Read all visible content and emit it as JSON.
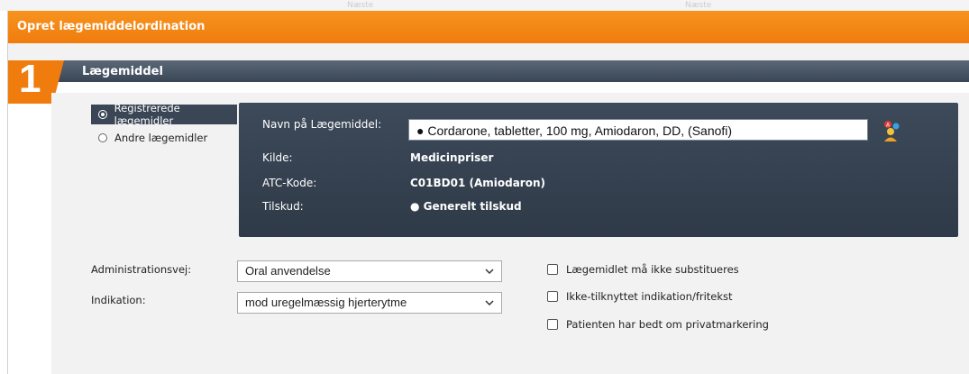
{
  "background_tabs": {
    "ghost_left": "Næste",
    "ghost_right": "Næste"
  },
  "dialog": {
    "title": "Opret lægemiddelordination"
  },
  "section": {
    "number": "1",
    "title": "Lægemiddel"
  },
  "source_options": [
    {
      "label": "Registrerede lægemidler",
      "selected": true
    },
    {
      "label": "Andre lægemidler",
      "selected": false
    }
  ],
  "drug_panel": {
    "name_label": "Navn på Lægemiddel:",
    "name_value": "● Cordarone, tabletter, 100 mg, Amiodaron, DD, (Sanofi)",
    "source_label": "Kilde:",
    "source_value": "Medicinpriser",
    "atc_label": "ATC-Kode:",
    "atc_value": "C01BD01 (Amiodaron)",
    "subsidy_label": "Tilskud:",
    "subsidy_value": "● Generelt tilskud",
    "lookup_icon": "drug-lookup-icon"
  },
  "form": {
    "route_label": "Administrationsvej:",
    "route_value": "Oral anvendelse",
    "indication_label": "Indikation:",
    "indication_value": "mod uregelmæssig hjerterytme"
  },
  "checkboxes": [
    {
      "label": "Lægemidlet må ikke substitueres",
      "checked": false
    },
    {
      "label": "Ikke-tilknyttet indikation/fritekst",
      "checked": false
    },
    {
      "label": "Patienten har bedt om privatmarkering",
      "checked": false
    }
  ],
  "colors": {
    "accent": "#f07c0e",
    "panel": "#3a4655"
  }
}
